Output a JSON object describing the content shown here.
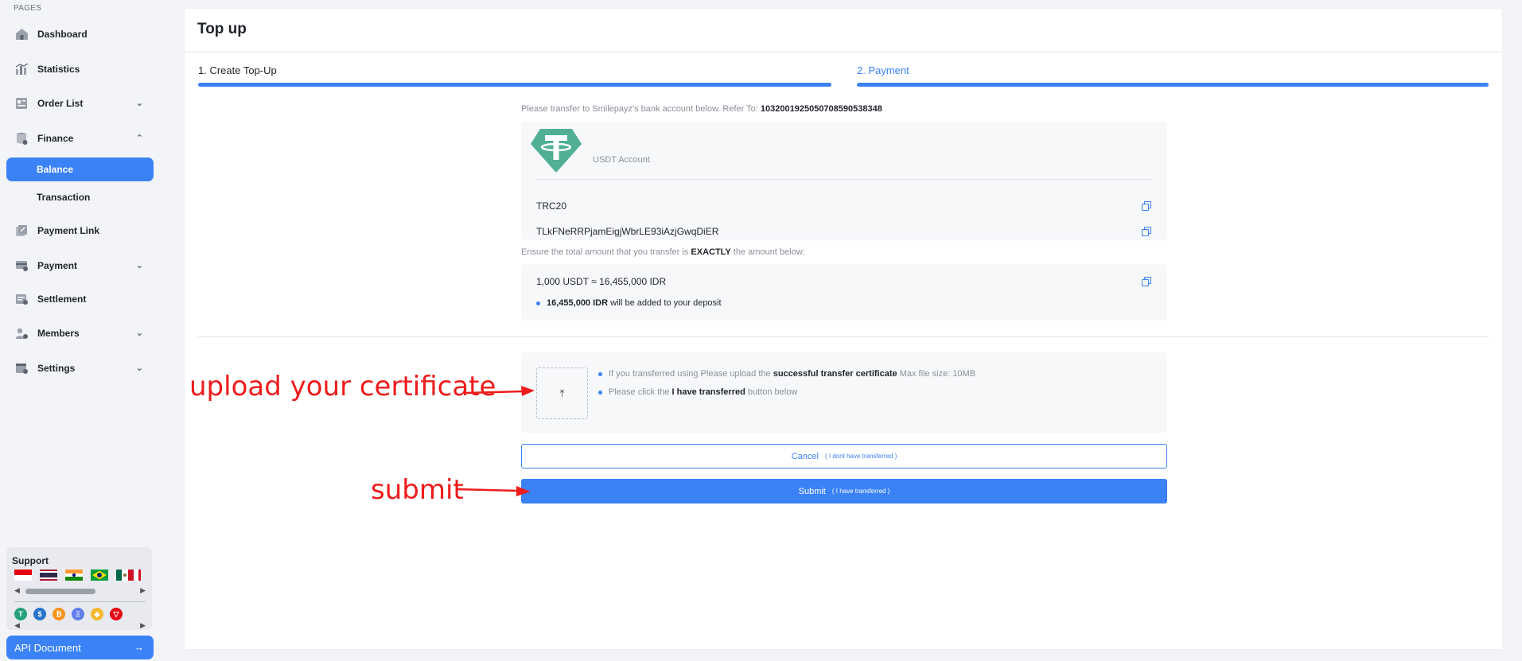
{
  "sidebar": {
    "section_label": "PAGES",
    "items": [
      {
        "label": "Dashboard",
        "icon": "home-icon"
      },
      {
        "label": "Statistics",
        "icon": "chart-icon"
      },
      {
        "label": "Order List",
        "icon": "list-icon",
        "expandable": true
      },
      {
        "label": "Finance",
        "icon": "database-icon",
        "expandable": true,
        "expanded": true
      },
      {
        "label": "Payment Link",
        "icon": "link-icon"
      },
      {
        "label": "Payment",
        "icon": "card-icon",
        "expandable": true
      },
      {
        "label": "Settlement",
        "icon": "settlement-icon"
      },
      {
        "label": "Members",
        "icon": "members-icon",
        "expandable": true
      },
      {
        "label": "Settings",
        "icon": "calendar-gear-icon",
        "expandable": true
      }
    ],
    "finance_sub": [
      {
        "label": "Balance",
        "active": true
      },
      {
        "label": "Transaction",
        "active": false
      }
    ],
    "support": {
      "title": "Support",
      "flags": [
        "indonesia-flag",
        "thailand-flag",
        "india-flag",
        "brazil-flag",
        "mexico-flag"
      ],
      "coins": [
        {
          "symbol": "T",
          "color": "#26a17b"
        },
        {
          "symbol": "$",
          "color": "#2775ca"
        },
        {
          "symbol": "₿",
          "color": "#f7931a"
        },
        {
          "symbol": "Ξ",
          "color": "#627eea"
        },
        {
          "symbol": "◆",
          "color": "#f3ba2f"
        },
        {
          "symbol": "▽",
          "color": "#e50914"
        }
      ]
    },
    "api_button": "API Document"
  },
  "page": {
    "title": "Top up",
    "steps": [
      {
        "label": "1. Create Top-Up",
        "active": false
      },
      {
        "label": "2. Payment",
        "active": true
      }
    ],
    "transfer_instruction": "Please transfer to Smilepayz's bank account below. Refer To:",
    "reference": "1032001925050708590538348",
    "account_label": "USDT Account",
    "network": "TRC20",
    "address": "TLkFNeRRPjamEigjWbrLE93iAzjGwqDiER",
    "amount_prefix": "Ensure the total amount that you transfer is",
    "amount_emphasis": "EXACTLY",
    "amount_suffix": "the amount below:",
    "conversion": "1,000 USDT ≈ 16,455,000 IDR",
    "deposit_amount": "16,455,000 IDR",
    "deposit_note": "will be added to your deposit",
    "upload_note1_prefix": "If you transferred using Please upload the",
    "upload_note1_bold": "successful transfer certificate",
    "upload_note1_suffix": "Max file size: 10MB",
    "upload_note2_prefix": "Please click the",
    "upload_note2_bold": "I have transferred",
    "upload_note2_suffix": "button below",
    "cancel_label": "Cancel",
    "cancel_hint": "( I dont have transferred )",
    "submit_label": "Submit",
    "submit_hint": "( I have transferred )",
    "accent_color": "#3b82f6"
  },
  "annotations": {
    "upload": "upload your certificate",
    "submit": "submit",
    "color": "#ee1c1c"
  }
}
